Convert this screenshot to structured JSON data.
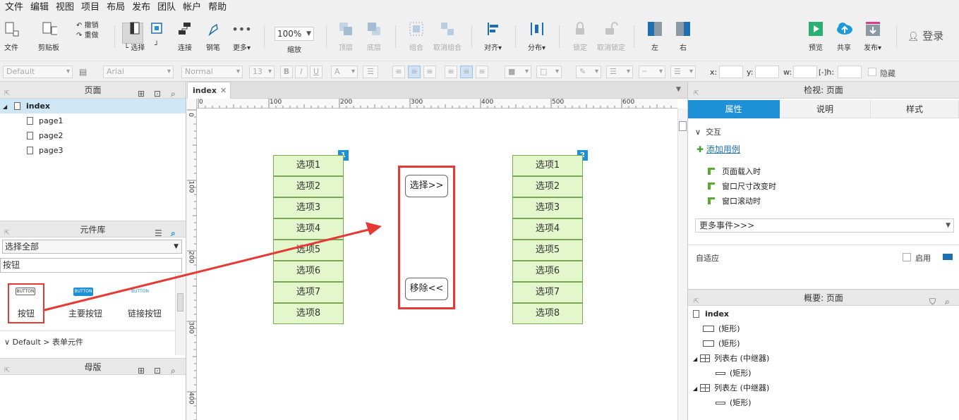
{
  "menu": [
    "文件",
    "编辑",
    "视图",
    "项目",
    "布局",
    "发布",
    "团队",
    "帐户",
    "帮助"
  ],
  "toolbar": {
    "file": "文件",
    "clipboard": "剪贴板",
    "undo": "撤销",
    "redo": "重做",
    "select": "选择",
    "connect": "连接",
    "pen": "钢笔",
    "more": "更多▾",
    "zoom_value": "100%",
    "zoom": "缩放",
    "top": "顶层",
    "bottom": "底层",
    "group": "组合",
    "ungroup": "取消组合",
    "align": "对齐▾",
    "distribute": "分布▾",
    "lock": "锁定",
    "unlock": "取消锁定",
    "left": "左",
    "right": "右",
    "preview": "预览",
    "share": "共享",
    "publish": "发布▾",
    "login": "登录"
  },
  "format": {
    "style": "Default",
    "font": "Arial",
    "weight": "Normal",
    "size": "13",
    "x": "x:",
    "y": "y:",
    "w": "w:",
    "h": "h:",
    "hide": "隐藏"
  },
  "pages": {
    "title": "页面",
    "root": "index",
    "children": [
      "page1",
      "page2",
      "page3"
    ]
  },
  "library": {
    "title": "元件库",
    "select": "选择全部",
    "search": "按钮",
    "items": [
      {
        "icon_text": "BUTTON",
        "label": "按钮"
      },
      {
        "icon_text": "BUTTON",
        "label": "主要按钮"
      },
      {
        "icon_text": "BUTTON",
        "label": "链接按钮"
      }
    ],
    "footer": "Default > 表单元件"
  },
  "masters": {
    "title": "母版"
  },
  "canvas": {
    "tab": "index",
    "hticks": [
      "0",
      "100",
      "200",
      "300",
      "400",
      "500",
      "600"
    ],
    "vticks": [
      "0",
      "100",
      "200",
      "300",
      "400"
    ],
    "list_left": {
      "badge": "1",
      "items": [
        "选项1",
        "选项2",
        "选项3",
        "选项4",
        "选项5",
        "选项6",
        "选项7",
        "选项8"
      ]
    },
    "list_right": {
      "badge": "2",
      "items": [
        "选项1",
        "选项2",
        "选项3",
        "选项4",
        "选项5",
        "选项6",
        "选项7",
        "选项8"
      ]
    },
    "btn_select": "选择>>",
    "btn_remove": "移除<<"
  },
  "inspector": {
    "title": "检视: 页面",
    "tabs": [
      "属性",
      "说明",
      "样式"
    ],
    "interaction": "交互",
    "add_case": "添加用例",
    "events": [
      "页面载入时",
      "窗口尺寸改变时",
      "窗口滚动时"
    ],
    "more_events": "更多事件>>>",
    "adaptive": "自适应",
    "enable": "启用"
  },
  "outline": {
    "title": "概要: 页面",
    "root": "index",
    "items": [
      {
        "type": "rect",
        "label": "(矩形)"
      },
      {
        "type": "rect",
        "label": "(矩形)"
      },
      {
        "type": "repeater",
        "label": "列表右 (中继器)"
      },
      {
        "type": "line",
        "label": "(矩形)"
      },
      {
        "type": "repeater",
        "label": "列表左 (中继器)"
      },
      {
        "type": "line",
        "label": "(矩形)"
      }
    ]
  },
  "colors": {
    "accent": "#1e90d8",
    "highlight": "#e53935",
    "list_fill": "#e4f7cc"
  }
}
